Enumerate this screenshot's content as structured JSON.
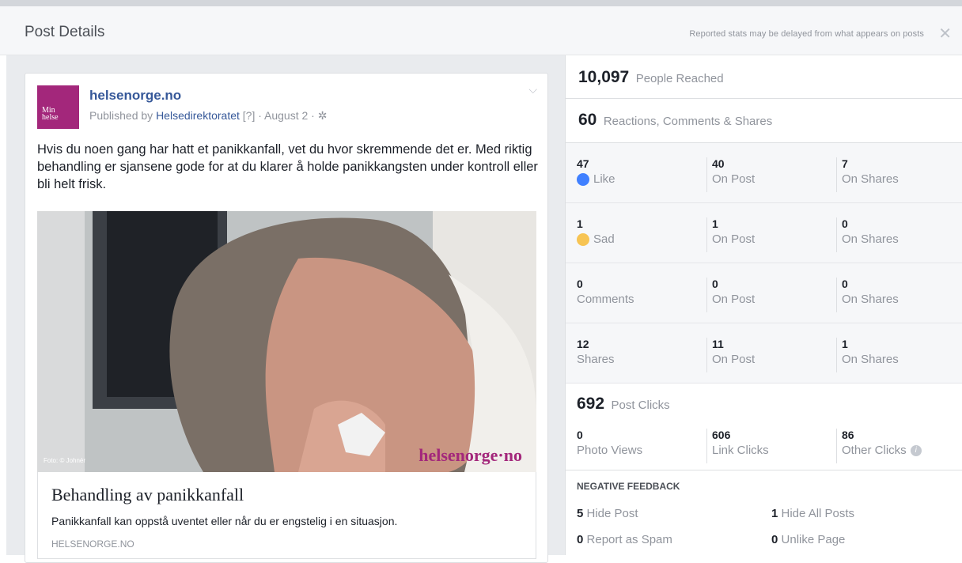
{
  "header": {
    "title": "Post Details",
    "note": "Reported stats may be delayed from what appears on posts",
    "close": "✕"
  },
  "post": {
    "avatar_text_1": "Min",
    "avatar_text_2": "helse",
    "page_name": "helsenorge.no",
    "published_prefix": "Published by",
    "published_by": "Helsedirektoratet",
    "published_suffix": "[?] · August 2 ·",
    "text": "Hvis du noen gang har hatt et panikkanfall, vet du hvor skremmende det er. Med riktig behandling er sjansene gode for at du klarer å holde panikkangsten under kontroll eller bli helt frisk.",
    "photo_credit": "Foto: © Johnér",
    "watermark": "helsenorge·no",
    "link_title": "Behandling av panikkanfall",
    "link_desc": "Panikkanfall kan oppstå uventet eller når du er engstelig i en situasjon.",
    "link_url": "HELSENORGE.NO"
  },
  "stats": {
    "reached_value": "10,097",
    "reached_label": "People Reached",
    "reactions_value": "60",
    "reactions_label": "Reactions, Comments & Shares",
    "rows": [
      {
        "v1": "47",
        "l1": "Like",
        "v2": "40",
        "l2": "On Post",
        "v3": "7",
        "l3": "On Shares"
      },
      {
        "v1": "1",
        "l1": "Sad",
        "v2": "1",
        "l2": "On Post",
        "v3": "0",
        "l3": "On Shares"
      },
      {
        "v1": "0",
        "l1": "Comments",
        "v2": "0",
        "l2": "On Post",
        "v3": "0",
        "l3": "On Shares"
      },
      {
        "v1": "12",
        "l1": "Shares",
        "v2": "11",
        "l2": "On Post",
        "v3": "1",
        "l3": "On Shares"
      }
    ],
    "clicks_value": "692",
    "clicks_label": "Post Clicks",
    "clicks": [
      {
        "v": "0",
        "l": "Photo Views"
      },
      {
        "v": "606",
        "l": "Link Clicks"
      },
      {
        "v": "86",
        "l": "Other Clicks"
      }
    ],
    "negative_title": "NEGATIVE FEEDBACK",
    "negative": [
      {
        "v": "5",
        "l": "Hide Post"
      },
      {
        "v": "1",
        "l": "Hide All Posts"
      },
      {
        "v": "0",
        "l": "Report as Spam"
      },
      {
        "v": "0",
        "l": "Unlike Page"
      }
    ]
  }
}
